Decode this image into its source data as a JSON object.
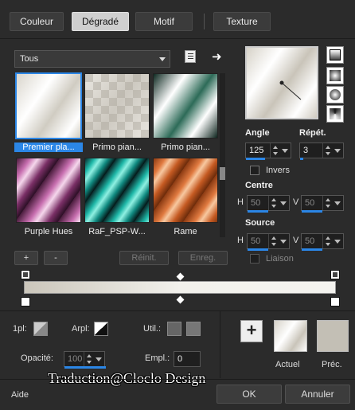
{
  "tabs": [
    "Couleur",
    "Dégradé",
    "Motif",
    "Texture"
  ],
  "active_tab": "Dégradé",
  "category_dropdown": {
    "value": "Tous"
  },
  "swatches": [
    {
      "label": "Premier pla...",
      "selected": true
    },
    {
      "label": "Primo pian..."
    },
    {
      "label": "Primo pian..."
    },
    {
      "label": "Purple Hues"
    },
    {
      "label": "RaF_PSP-W..."
    },
    {
      "label": "Rame"
    }
  ],
  "buttons": {
    "add": "+",
    "remove": "-",
    "reset": "Réinit.",
    "save": "Enreg.",
    "ok": "OK",
    "cancel": "Annuler",
    "help": "Aide"
  },
  "angle": {
    "label": "Angle",
    "value": "125"
  },
  "repeat": {
    "label": "Répét.",
    "value": "3"
  },
  "invert": {
    "label": "Invers",
    "checked": false
  },
  "center": {
    "label": "Centre",
    "h_label": "H",
    "h_value": "50",
    "v_label": "V",
    "v_value": "50"
  },
  "source": {
    "label": "Source",
    "h_label": "H",
    "h_value": "50",
    "v_label": "V",
    "v_value": "50"
  },
  "link": {
    "label": "Liaison"
  },
  "bottom": {
    "pl_label": "1pl:",
    "arpl_label": "Arpl:",
    "util_label": "Util.:",
    "opacity_label": "Opacité:",
    "opacity_value": "100",
    "empl_label": "Empl.:",
    "empl_value": "0",
    "current_label": "Actuel",
    "previous_label": "Préc."
  },
  "watermark": "Traduction@Cloclo Design",
  "colors": {
    "accent": "#2b86e6",
    "background": "#2b2b2b",
    "gradient_start": "#cbc6bb",
    "gradient_end": "#f4f3ef"
  }
}
